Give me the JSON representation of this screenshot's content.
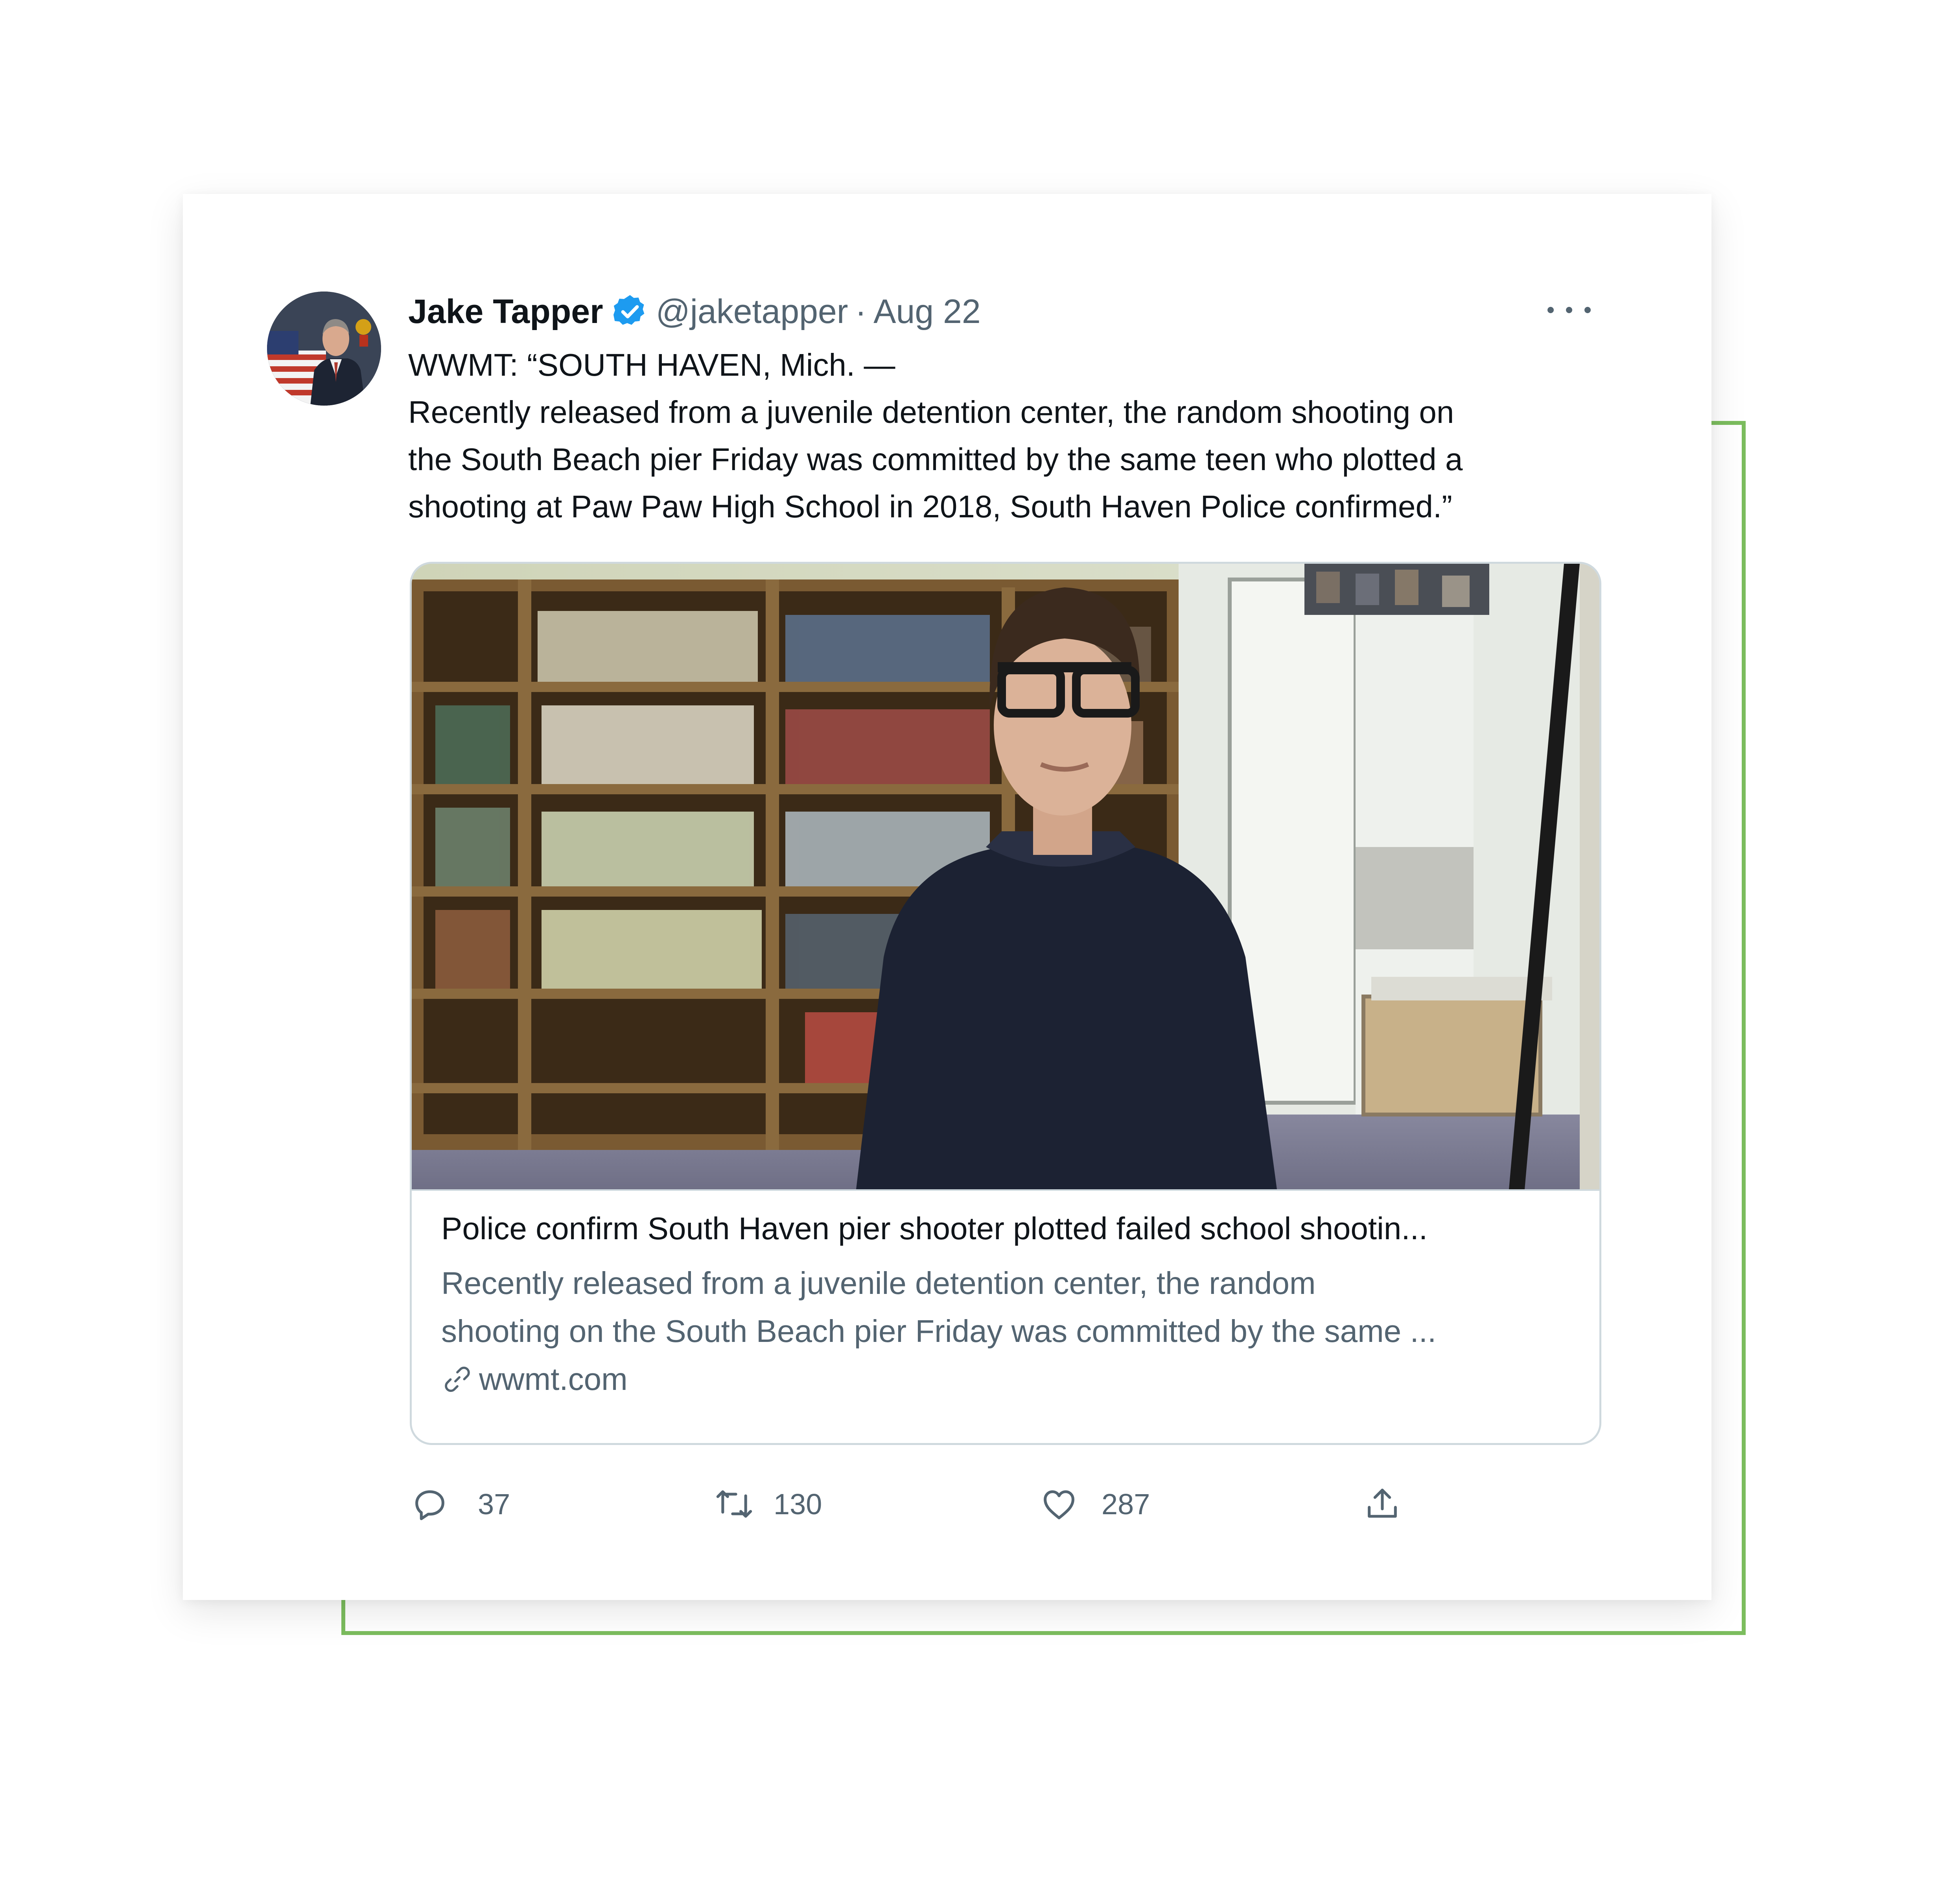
{
  "tweet": {
    "author_name": "Jake Tapper",
    "handle": "@jaketapper",
    "separator": "·",
    "date": "Aug 22",
    "text_lines": [
      "WWMT: “SOUTH HAVEN, Mich. —",
      "Recently released from a juvenile detention center, the random shooting on",
      "the South Beach pier Friday was committed by the same teen who plotted a",
      "shooting at Paw Paw High School in 2018, South Haven Police confirmed.”"
    ]
  },
  "link_card": {
    "title": "Police confirm South Haven pier shooter plotted failed school shootin...",
    "description_lines": [
      "Recently released from a juvenile detention center, the random",
      "shooting on the South Beach pier Friday was committed by the same ..."
    ],
    "domain": "wwmt.com"
  },
  "actions": {
    "replies": "37",
    "retweets": "130",
    "likes": "287"
  },
  "icons": {
    "verified": "verified-badge-icon",
    "more": "more-options-icon",
    "link": "link-icon",
    "reply": "reply-icon",
    "retweet": "retweet-icon",
    "like": "heart-icon",
    "share": "share-icon"
  },
  "colors": {
    "accent_frame": "#7cbd5e",
    "verified_blue": "#1d9bf0",
    "primary_text": "#0f1419",
    "secondary_text": "#536471",
    "card_border": "#cfd9de"
  }
}
